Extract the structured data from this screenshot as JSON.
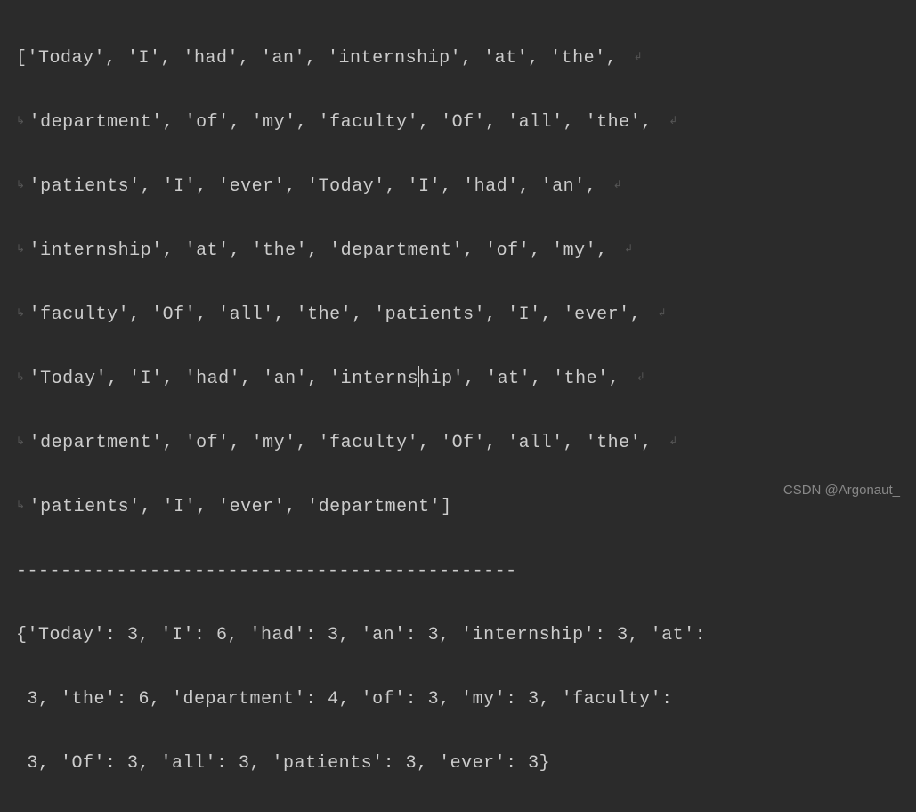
{
  "output": {
    "list_display": "['Today', 'I', 'had', 'an', 'internship', 'at', 'the', 'department', 'of', 'my', 'faculty', 'Of', 'all', 'the', 'patients', 'I', 'ever', 'Today', 'I', 'had', 'an', 'internship', 'at', 'the', 'department', 'of', 'my', 'faculty', 'Of', 'all', 'the', 'patients', 'I', 'ever', 'Today', 'I', 'had', 'an', 'internship', 'at', 'the', 'department', 'of', 'my', 'faculty', 'Of', 'all', 'the', 'patients', 'I', 'ever', 'department']",
    "list_items": [
      "Today",
      "I",
      "had",
      "an",
      "internship",
      "at",
      "the",
      "department",
      "of",
      "my",
      "faculty",
      "Of",
      "all",
      "the",
      "patients",
      "I",
      "ever",
      "Today",
      "I",
      "had",
      "an",
      "internship",
      "at",
      "the",
      "department",
      "of",
      "my",
      "faculty",
      "Of",
      "all",
      "the",
      "patients",
      "I",
      "ever",
      "Today",
      "I",
      "had",
      "an",
      "internship",
      "at",
      "the",
      "department",
      "of",
      "my",
      "faculty",
      "Of",
      "all",
      "the",
      "patients",
      "I",
      "ever",
      "department"
    ],
    "divider": "---------------------------------------------",
    "dict_display": "{'Today': 3, 'I': 6, 'had': 3, 'an': 3, 'internship': 3, 'at': 3, 'the': 6, 'department': 4, 'of': 3, 'my': 3, 'faculty': 3, 'Of': 3, 'all': 3, 'patients': 3, 'ever': 3}",
    "word_counts": {
      "Today": 3,
      "I": 6,
      "had": 3,
      "an": 3,
      "internship": 3,
      "at": 3,
      "the": 6,
      "department": 4,
      "of": 3,
      "my": 3,
      "faculty": 3,
      "Of": 3,
      "all": 3,
      "patients": 3,
      "ever": 3
    }
  },
  "lines": {
    "l1": "['Today', 'I', 'had', 'an', 'internship', 'at', 'the', ",
    "l2": "'department', 'of', 'my', 'faculty', 'Of', 'all', 'the', ",
    "l3": "'patients', 'I', 'ever', 'Today', 'I', 'had', 'an', ",
    "l4": "'internship', 'at', 'the', 'department', 'of', 'my', ",
    "l5": "'faculty', 'Of', 'all', 'the', 'patients', 'I', 'ever', ",
    "l6a": "'Today', 'I', 'had', 'an', 'interns",
    "l6b": "hip', 'at', 'the', ",
    "l7": "'department', 'of', 'my', 'faculty', 'Of', 'all', 'the', ",
    "l8": "'patients', 'I', 'ever', 'department']",
    "l9": "---------------------------------------------",
    "l10": "{'Today': 3, 'I': 6, 'had': 3, 'an': 3, 'internship': 3, 'at':",
    "l11": " 3, 'the': 6, 'department': 4, 'of': 3, 'my': 3, 'faculty':",
    "l12": " 3, 'Of': 3, 'all': 3, 'patients': 3, 'ever': 3}"
  },
  "watermark": "CSDN @Argonaut_",
  "wrap_symbol_start": "↳",
  "wrap_symbol_end": "↲"
}
